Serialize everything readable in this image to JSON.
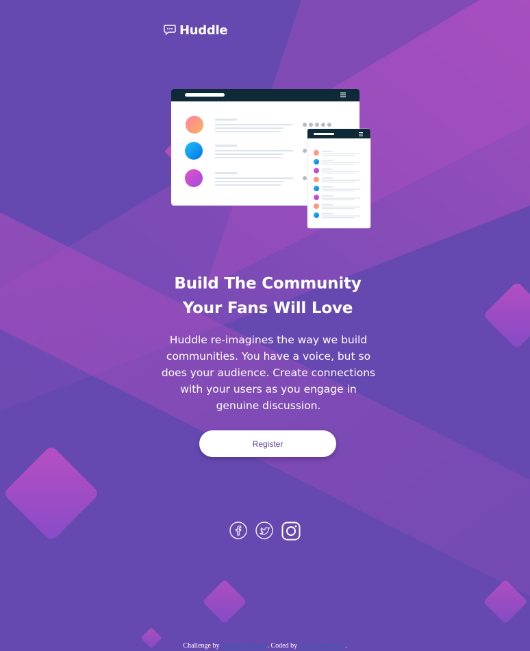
{
  "brand": {
    "name": "Huddle",
    "logo_icon": "chat-bubble-icon"
  },
  "hero": {
    "headline_line1": "Build The Community",
    "headline_line2": "Your Fans Will Love",
    "body": "Huddle re-imagines the way we build communities. You have a voice, but so does your audience. Create connections with your users as you engage in genuine discussion.",
    "cta_label": "Register"
  },
  "socials": [
    {
      "name": "facebook-icon"
    },
    {
      "name": "twitter-icon"
    },
    {
      "name": "instagram-icon"
    }
  ],
  "footer": {
    "prefix": "Challenge by",
    "link1": "Frontend Mentor",
    "middle": ". Coded by",
    "link2": "Your Name Here",
    "suffix": "."
  },
  "colors": {
    "background": "#6649b0",
    "accent_pink": "#c74fd0",
    "button_text": "#5f3f9f",
    "mockup_header": "#0e2a39"
  }
}
